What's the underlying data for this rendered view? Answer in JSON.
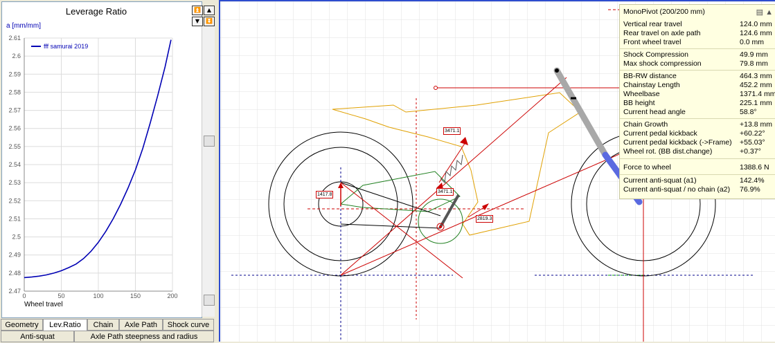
{
  "left_panel": {
    "chart_title": "Leverage Ratio",
    "y_unit_label": "a [mm/mm]",
    "x_axis_label": "Wheel travel",
    "legend_label": "fff samurai 2019",
    "series_color": "#0000b4"
  },
  "chart_data": {
    "type": "line",
    "title": "Leverage Ratio",
    "xlabel": "Wheel travel",
    "ylabel": "a [mm/mm]",
    "xlim": [
      0,
      200
    ],
    "ylim": [
      2.47,
      2.61
    ],
    "x_ticks": [
      "0",
      "50",
      "100",
      "150",
      "200"
    ],
    "y_ticks": [
      "2.47",
      "2.48",
      "2.49",
      "2.5",
      "2.51",
      "2.52",
      "2.53",
      "2.54",
      "2.55",
      "2.56",
      "2.57",
      "2.58",
      "2.59",
      "2.6",
      "2.61"
    ],
    "grid": true,
    "legend_placement": "top-left",
    "series": [
      {
        "name": "fff samurai 2019",
        "x": [
          0,
          10,
          20,
          30,
          40,
          50,
          60,
          70,
          80,
          90,
          100,
          110,
          120,
          130,
          140,
          150,
          160,
          170,
          180,
          190,
          198
        ],
        "values": [
          2.4775,
          2.4778,
          2.4783,
          2.479,
          2.48,
          2.4813,
          2.483,
          2.485,
          2.488,
          2.492,
          2.497,
          2.503,
          2.51,
          2.518,
          2.527,
          2.537,
          2.549,
          2.563,
          2.578,
          2.594,
          2.609
        ]
      }
    ]
  },
  "tabs": {
    "row1": [
      {
        "label": "Geometry",
        "active": false
      },
      {
        "label": "Lev.Ratio",
        "active": true
      },
      {
        "label": "Chain",
        "active": false
      },
      {
        "label": "Axle Path",
        "active": false
      },
      {
        "label": "Shock curve",
        "active": false
      }
    ],
    "row2": [
      {
        "label": "Anti-squat",
        "active": false
      },
      {
        "label": "Axle Path steepness and radius",
        "active": false
      }
    ]
  },
  "info_panel": {
    "title": "MonoPivot (200/200 mm)",
    "groups": [
      [
        {
          "label": "Vertical rear travel",
          "value": "124.0 mm"
        },
        {
          "label": "Rear travel on axle path",
          "value": "124.6 mm"
        },
        {
          "label": "Front wheel travel",
          "value": "0.0 mm"
        }
      ],
      [
        {
          "label": "Shock Compression",
          "value": "49.9 mm"
        },
        {
          "label": "Max shock compression",
          "value": "79.8 mm"
        }
      ],
      [
        {
          "label": "BB-RW distance",
          "value": "464.3 mm"
        },
        {
          "label": "Chainstay Length",
          "value": "452.2 mm"
        },
        {
          "label": "Wheelbase",
          "value": "1371.4 mm"
        },
        {
          "label": "BB height",
          "value": "225.1 mm"
        },
        {
          "label": "Current head angle",
          "value": "58.8°"
        }
      ],
      [
        {
          "label": "Chain Growth",
          "value": "+13.8 mm"
        },
        {
          "label": "Current pedal kickback",
          "value": "+60.22°"
        },
        {
          "label": "Current pedal kickback (->Frame)",
          "value": "+55.03°"
        },
        {
          "label": "Wheel rot. (BB dist.change)",
          "value": "+0.37°"
        }
      ],
      [
        {
          "label": "Force to wheel",
          "value": "1388.6 N"
        }
      ],
      [
        {
          "label": "Current anti-squat (a1)",
          "value": "142.4%"
        },
        {
          "label": "Current anti-squat / no chain (a2)",
          "value": "76.9%"
        }
      ]
    ]
  },
  "drawing_labels": {
    "shock_force": "3471.1",
    "shock_force_2": "3471.1",
    "rear_axle_force": "1417.8",
    "chain_force": "2819.3"
  },
  "icons": {
    "chart_scroll": [
      "arrow-top-icon",
      "arrow-up-icon",
      "arrow-down-icon",
      "arrow-bottom-icon"
    ],
    "info_corner": [
      "layout-icon",
      "collapse-icon"
    ]
  }
}
